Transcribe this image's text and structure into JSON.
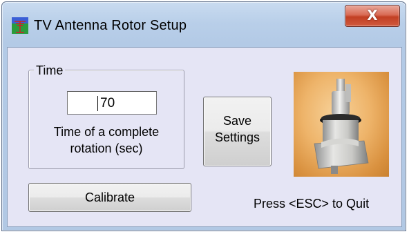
{
  "window": {
    "title": "TV Antenna Rotor Setup",
    "title_icon": "antenna-app-icon",
    "close_icon": "close-x-icon",
    "close_label": "X"
  },
  "colors": {
    "title_gradient_top": "#c9dbf0",
    "client_bg": "#e5e5f5",
    "close_red": "#c23f23",
    "photo_orange": "#eeb46a"
  },
  "time_group": {
    "legend": "Time",
    "input_value": "70",
    "description_line1": "Time of a complete",
    "description_line2": "rotation (sec)"
  },
  "buttons": {
    "save_line1": "Save",
    "save_line2": "Settings",
    "calibrate": "Calibrate"
  },
  "image": {
    "icon": "antenna-rotor-photo"
  },
  "footer": {
    "quit_text": "Press <ESC> to Quit"
  }
}
